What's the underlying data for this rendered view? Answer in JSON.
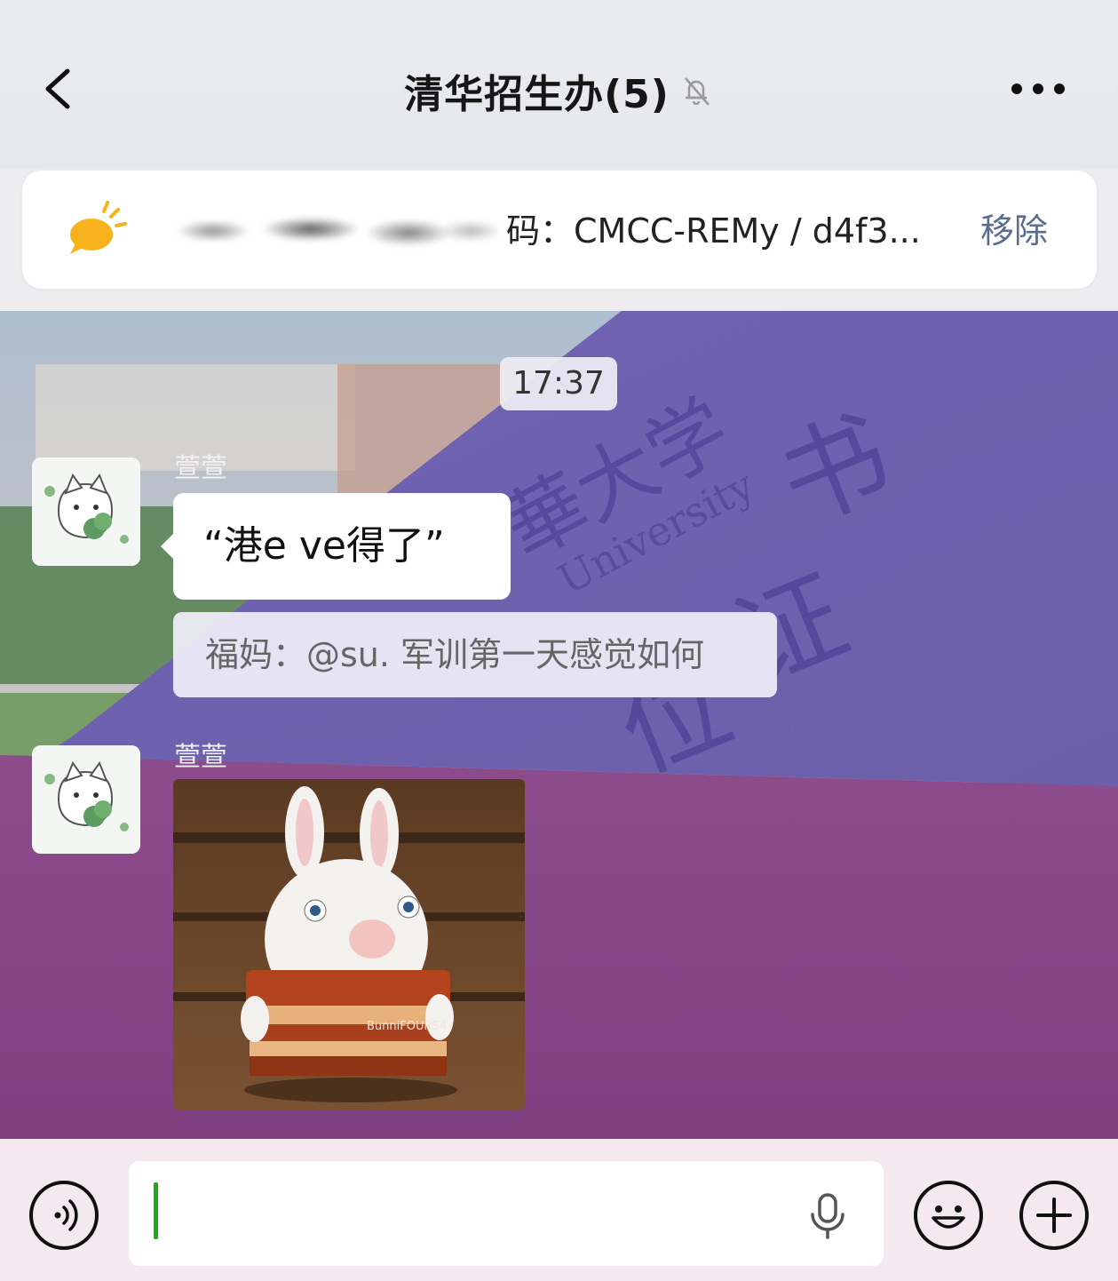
{
  "header": {
    "title": "清华招生办(5)",
    "icons": {
      "back": "chevron-left-icon",
      "mute": "bell-slash-icon",
      "more": "more-dots-icon"
    }
  },
  "pinned_notice": {
    "visible_text": "码：CMCC-REMy / d4f3...",
    "remove_label": "移除",
    "icon": "speech-bubble-sun-icon",
    "icon_color": "#f7b21c"
  },
  "chat": {
    "timestamp": "17:37",
    "messages": [
      {
        "sender": "萱萱",
        "type": "text",
        "text": "“港e ve得了”",
        "quote": "福妈：@su. 军训第一天感觉如何"
      },
      {
        "sender": "萱萱",
        "type": "sticker",
        "sticker_text": "BunniFOURS4"
      }
    ]
  },
  "input_bar": {
    "icons": {
      "voice": "voice-wave-icon",
      "mic": "microphone-icon",
      "emoji": "smile-face-icon",
      "plus": "plus-icon"
    },
    "caret_color": "#1aad19"
  }
}
